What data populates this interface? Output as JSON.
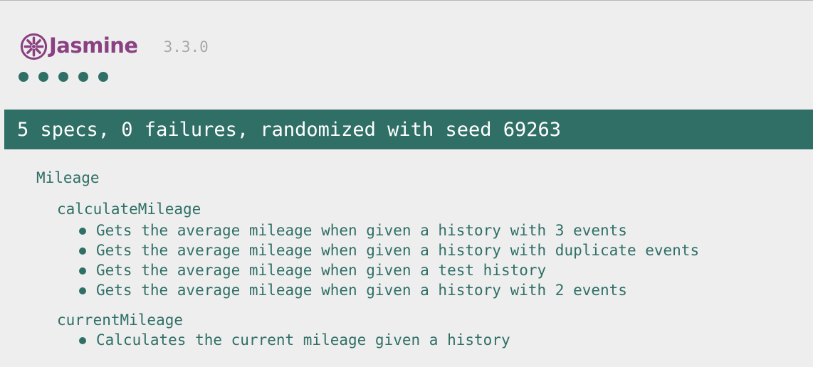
{
  "colors": {
    "background": "#eeeeee",
    "brand_purple": "#8a4182",
    "pass_green": "#2f6f66",
    "text_teal": "#2f6f66",
    "version_gray": "#a8a8a8",
    "bar_text": "#ffffff"
  },
  "banner": {
    "logo_text": "Jasmine",
    "version": "3.3.0",
    "logo_icon": "jasmine-flower-icon"
  },
  "dots": {
    "passed_count": 5,
    "status": "passed"
  },
  "summary": {
    "text": "5 specs, 0 failures, randomized with seed 69263"
  },
  "suite": {
    "title": "Mileage",
    "children": [
      {
        "title": "calculateMileage",
        "specs": [
          "Gets the average mileage when given a history with 3 events",
          "Gets the average mileage when given a history with duplicate events",
          "Gets the average mileage when given a test history",
          "Gets the average mileage when given a history with 2 events"
        ]
      },
      {
        "title": "currentMileage",
        "specs": [
          "Calculates the current mileage given a history"
        ]
      }
    ]
  }
}
